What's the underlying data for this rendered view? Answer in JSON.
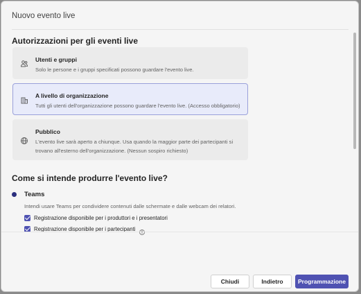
{
  "dialog": {
    "title": "Nuovo evento live"
  },
  "permissions": {
    "heading": "Autorizzazioni per gli eventi live",
    "options": [
      {
        "label": "Utenti e gruppi",
        "description": "Solo le persone e i gruppi specificati possono guardare l'evento live.",
        "icon": "people-icon",
        "selected": false
      },
      {
        "label": "A livello di organizzazione",
        "description": "Tutti gli utenti dell'organizzazione possono guardare l'evento live. (Accesso obbligatorio)",
        "icon": "building-icon",
        "selected": true
      },
      {
        "label": "Pubblico",
        "description": "L'evento live sarà aperto a chiunque. Usa quando la maggior parte dei partecipanti si trovano all'esterno dell'organizzazione. (Nessun sospiro richiesto)",
        "icon": "globe-icon",
        "selected": false
      }
    ]
  },
  "production": {
    "heading": "Come si intende produrre l'evento live?",
    "selected_option": {
      "label": "Teams",
      "description": "Intendi usare Teams per condividere contenuti dalle schermate e dalle webcam dei relatori."
    },
    "checkboxes": [
      {
        "label": "Registrazione disponibile per i produttori e i presentatori",
        "checked": true
      },
      {
        "label": "Registrazione disponibile per i partecipanti",
        "checked": true
      }
    ]
  },
  "footer": {
    "close_label": "Chiudi",
    "back_label": "Indietro",
    "schedule_label": "Programmazione"
  },
  "colors": {
    "accent": "#4f52b2",
    "selected_card_bg": "#e8ebfa",
    "card_bg": "#ebebeb",
    "dialog_bg": "#f5f5f5"
  }
}
